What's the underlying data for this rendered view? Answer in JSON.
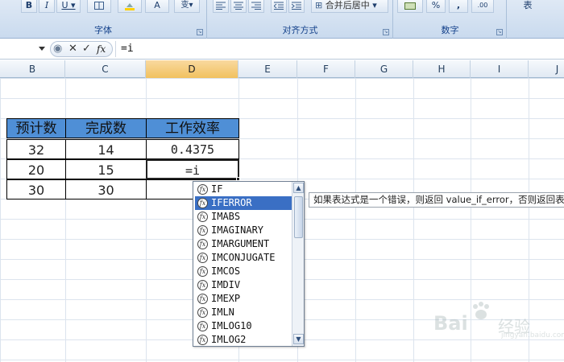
{
  "ribbon": {
    "groups": [
      {
        "label": "字体"
      },
      {
        "label": "对齐方式"
      },
      {
        "label": "数字"
      }
    ],
    "merge_center_label": "合并后居中",
    "percent_label": "%",
    "comma_label": ",",
    "right_partial_label": "表"
  },
  "formula_bar": {
    "cancel_symbol": "✕",
    "enter_symbol": "✓",
    "fx_symbol": "fx",
    "formula": "=i"
  },
  "columns": [
    {
      "label": "B"
    },
    {
      "label": "C"
    },
    {
      "label": "D",
      "selected": true
    },
    {
      "label": "E"
    },
    {
      "label": "F"
    },
    {
      "label": "G"
    },
    {
      "label": "H"
    },
    {
      "label": "I"
    },
    {
      "label": "J"
    }
  ],
  "table": {
    "headers": [
      "预计数",
      "完成数",
      "工作效率"
    ],
    "header_color": "#4f8fd6",
    "rows": [
      [
        "32",
        "14",
        "0.4375"
      ],
      [
        "20",
        "15",
        "=i"
      ],
      [
        "30",
        "30",
        ""
      ]
    ]
  },
  "autocomplete": {
    "items": [
      "IF",
      "IFERROR",
      "IMABS",
      "IMAGINARY",
      "IMARGUMENT",
      "IMCONJUGATE",
      "IMCOS",
      "IMDIV",
      "IMEXP",
      "IMLN",
      "IMLOG10",
      "IMLOG2"
    ],
    "selected_index": 1,
    "scroll_up": "▲",
    "scroll_down": "▼",
    "item_icon": "fx-function-icon",
    "selection_color": "#3a6fc4"
  },
  "tooltip": {
    "text": "如果表达式是一个错误，则返回 value_if_error，否则返回表"
  },
  "watermark": {
    "text": "Bai",
    "cn": "经验",
    "sub": "jingyan.baidu.com"
  }
}
